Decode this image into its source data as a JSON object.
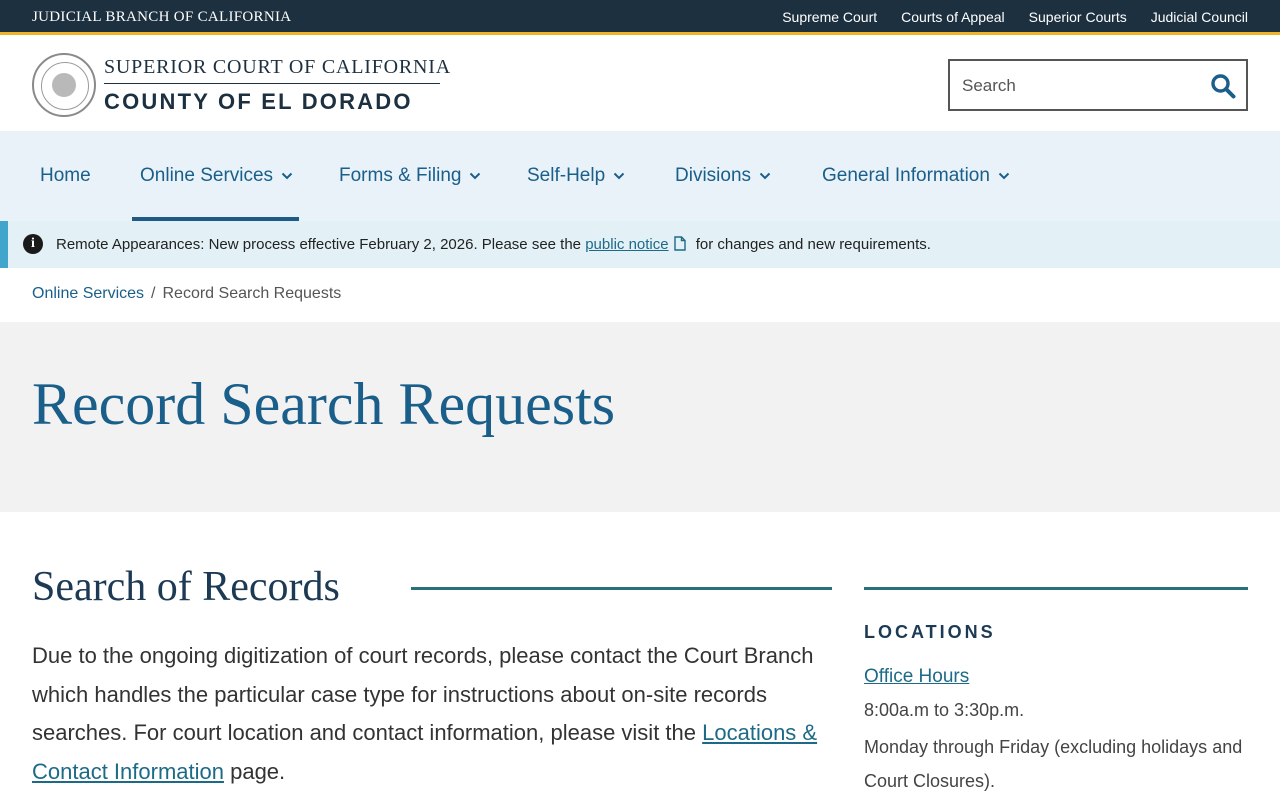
{
  "topbar": {
    "brand": "Judicial Branch of California",
    "links": [
      "Supreme Court",
      "Courts of Appeal",
      "Superior Courts",
      "Judicial Council"
    ]
  },
  "header": {
    "court_line1": "Superior Court of California",
    "court_line2": "County of El Dorado",
    "search_placeholder": "Search"
  },
  "nav": {
    "items": [
      {
        "label": "Home"
      },
      {
        "label": "Online Services"
      },
      {
        "label": "Forms & Filing"
      },
      {
        "label": "Self-Help"
      },
      {
        "label": "Divisions"
      },
      {
        "label": "General Information"
      }
    ],
    "active": "Online Services"
  },
  "alert": {
    "text_before": "Remote Appearances: New process effective February 2, 2026. Please see the ",
    "link": "public notice",
    "text_after": " for changes and new requirements."
  },
  "breadcrumb": {
    "parent": "Online Services",
    "separator": "/",
    "current": "Record Search Requests"
  },
  "page": {
    "title": "Record Search Requests"
  },
  "content": {
    "heading": "Search of Records",
    "para_text": "Due to the ongoing digitization of court records, please contact the Court Branch which handles the particular case type for instructions about on-site records searches.   For court location and contact information, please visit the ",
    "para_link": "Locations & Contact Information",
    "para_end": " page."
  },
  "sidebar": {
    "title": "Locations",
    "link": "Office Hours",
    "hours": "8:00a.m to 3:30p.m.",
    "days": "Monday through Friday (excluding holidays and Court Closures)."
  },
  "colors": {
    "topbar_bg": "#1d3040",
    "topbar_accent": "#f2b32a",
    "nav_bg": "#e8f2f8",
    "link": "#1a5e8a",
    "alert_accent": "#42a6cc",
    "rule": "#2a6f7c"
  }
}
